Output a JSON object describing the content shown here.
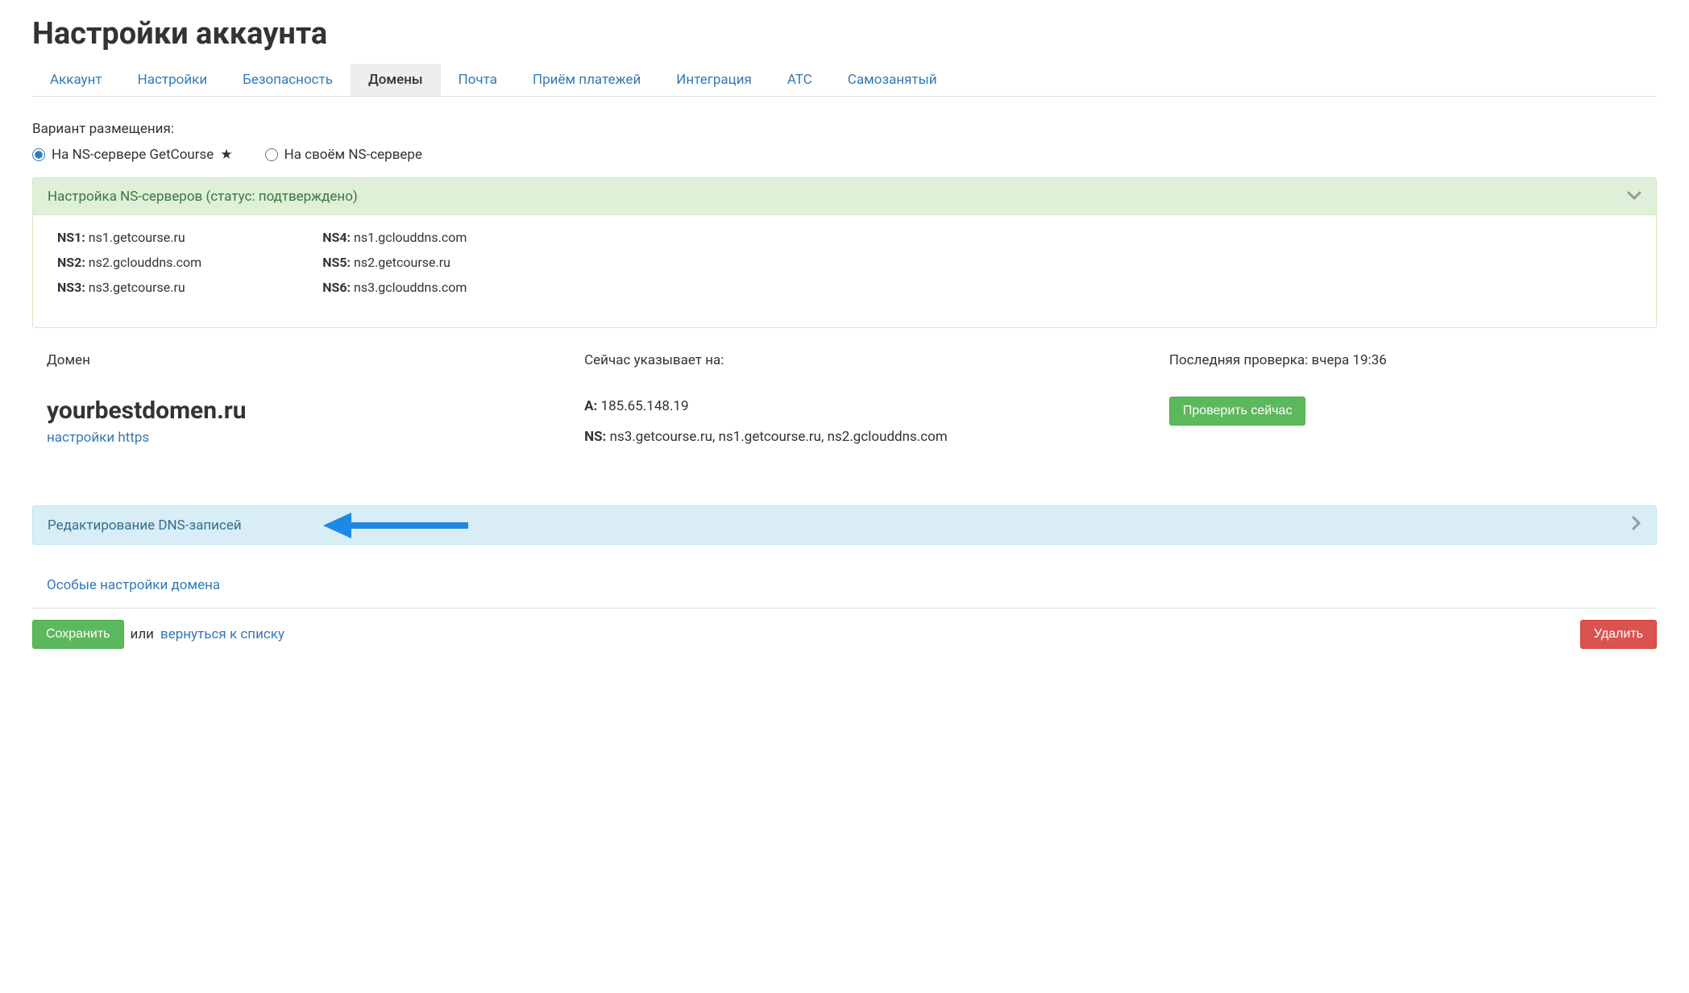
{
  "page_title": "Настройки аккаунта",
  "tabs": [
    {
      "label": "Аккаунт",
      "active": false
    },
    {
      "label": "Настройки",
      "active": false
    },
    {
      "label": "Безопасность",
      "active": false
    },
    {
      "label": "Домены",
      "active": true
    },
    {
      "label": "Почта",
      "active": false
    },
    {
      "label": "Приём платежей",
      "active": false
    },
    {
      "label": "Интеграция",
      "active": false
    },
    {
      "label": "АТС",
      "active": false
    },
    {
      "label": "Самозанятый",
      "active": false
    }
  ],
  "placement": {
    "label": "Вариант размещения:",
    "option1": "На NS-сервере GetCourse",
    "option2": "На своём NS-сервере"
  },
  "ns_panel": {
    "title": "Настройка NS-серверов (статус: подтверждено)",
    "col1": [
      {
        "label": "NS1:",
        "value": "ns1.getcourse.ru"
      },
      {
        "label": "NS2:",
        "value": "ns2.gclouddns.com"
      },
      {
        "label": "NS3:",
        "value": "ns3.getcourse.ru"
      }
    ],
    "col2": [
      {
        "label": "NS4:",
        "value": "ns1.gclouddns.com"
      },
      {
        "label": "NS5:",
        "value": "ns2.getcourse.ru"
      },
      {
        "label": "NS6:",
        "value": "ns3.gclouddns.com"
      }
    ]
  },
  "domain": {
    "label": "Домен",
    "name": "yourbestdomen.ru",
    "https_link": "настройки https"
  },
  "points_to": {
    "label": "Сейчас указывает на:",
    "a_label": "A:",
    "a_value": "185.65.148.19",
    "ns_label": "NS:",
    "ns_value": "ns3.getcourse.ru, ns1.getcourse.ru, ns2.gclouddns.com"
  },
  "last_check": {
    "label": "Последняя проверка: вчера 19:36",
    "button": "Проверить сейчас"
  },
  "dns_edit_panel": "Редактирование DNS-записей",
  "special_settings": "Особые настройки домена",
  "footer": {
    "save": "Сохранить",
    "or": "или",
    "back": "вернуться к списку",
    "delete": "Удалить"
  }
}
